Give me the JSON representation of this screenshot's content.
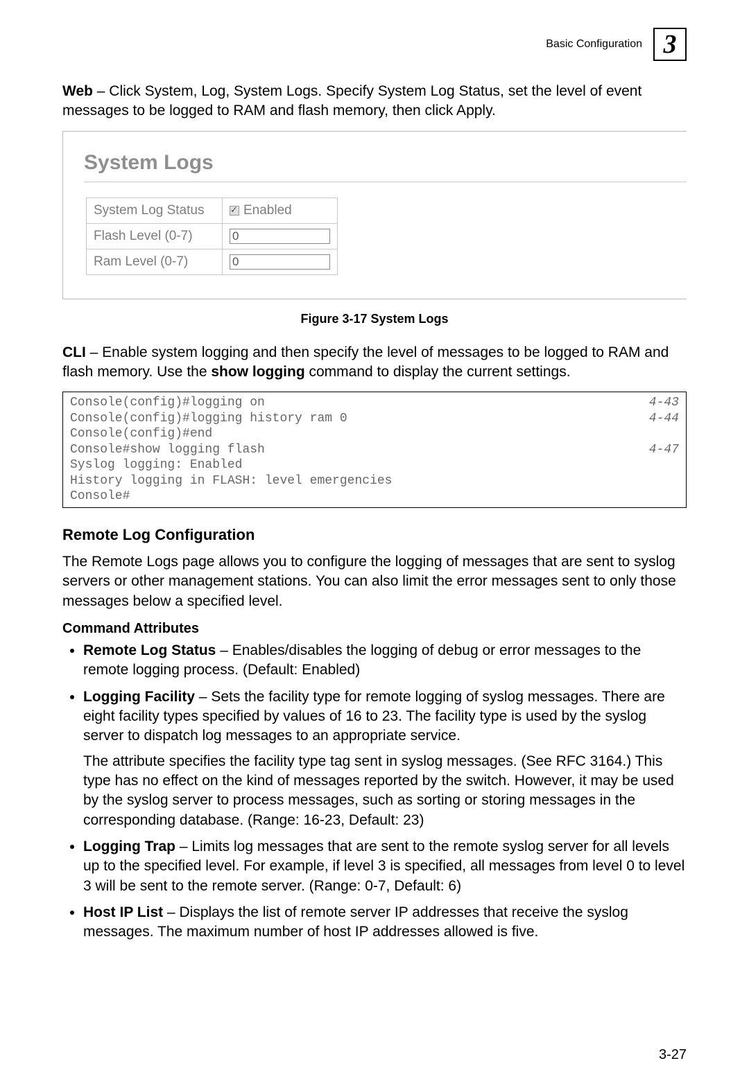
{
  "header": {
    "title": "Basic Configuration",
    "chapter": "3"
  },
  "web_para": {
    "prefix": "Web",
    "rest": " – Click System, Log, System Logs. Specify System Log Status, set the level of event messages to be logged to RAM and flash memory, then click Apply."
  },
  "screenshot": {
    "title": "System Logs",
    "rows": {
      "status": {
        "label": "System Log Status",
        "checkbox_label": "Enabled"
      },
      "flash": {
        "label": "Flash Level (0-7)",
        "value": "0"
      },
      "ram": {
        "label": "Ram Level (0-7)",
        "value": "0"
      }
    }
  },
  "figure_caption": "Figure 3-17  System Logs",
  "cli_para": {
    "prefix": "CLI",
    "mid": " – Enable system logging and then specify the level of messages to be logged to RAM and flash memory. Use the ",
    "cmd": "show logging",
    "tail": " command to display the current settings."
  },
  "cli": {
    "lines": [
      {
        "text": "Console(config)#logging on",
        "ref": "4-43"
      },
      {
        "text": "Console(config)#logging history ram 0",
        "ref": "4-44"
      },
      {
        "text": "Console(config)#end",
        "ref": ""
      },
      {
        "text": "Console#show logging flash",
        "ref": "4-47"
      },
      {
        "text": "Syslog logging: Enabled",
        "ref": ""
      },
      {
        "text": "History logging in FLASH: level emergencies",
        "ref": ""
      },
      {
        "text": "Console#",
        "ref": ""
      }
    ]
  },
  "section": {
    "heading": "Remote Log Configuration",
    "intro": "The Remote Logs page allows you to configure the logging of messages that are sent to syslog servers or other management stations. You can also limit the error messages sent to only those messages below a specified level.",
    "command_attr_heading": "Command Attributes",
    "bullets": [
      {
        "label": "Remote Log Status",
        "text": " – Enables/disables the logging of debug or error messages to the remote logging process. (Default: Enabled)"
      },
      {
        "label": "Logging Facility",
        "text": " – Sets the facility type for remote logging of syslog messages. There are eight facility types specified by values of 16 to 23. The facility type is used by the syslog server to dispatch log messages to an appropriate service.",
        "sub": "The attribute specifies the facility type tag sent in syslog messages. (See RFC 3164.) This type has no effect on the kind of messages reported by the switch. However, it may be used by the syslog server to process messages, such as sorting or storing messages in the corresponding database. (Range: 16-23, Default: 23)"
      },
      {
        "label": "Logging Trap",
        "text": " – Limits log messages that are sent to the remote syslog server for all levels up to the specified level. For example, if level 3 is specified, all messages from level 0 to level 3 will be sent to the remote server. (Range: 0-7, Default: 6)"
      },
      {
        "label": "Host IP List",
        "text": " – Displays the list of remote server IP addresses that receive the syslog messages. The maximum number of host IP addresses allowed is five."
      }
    ]
  },
  "page_number": "3-27"
}
